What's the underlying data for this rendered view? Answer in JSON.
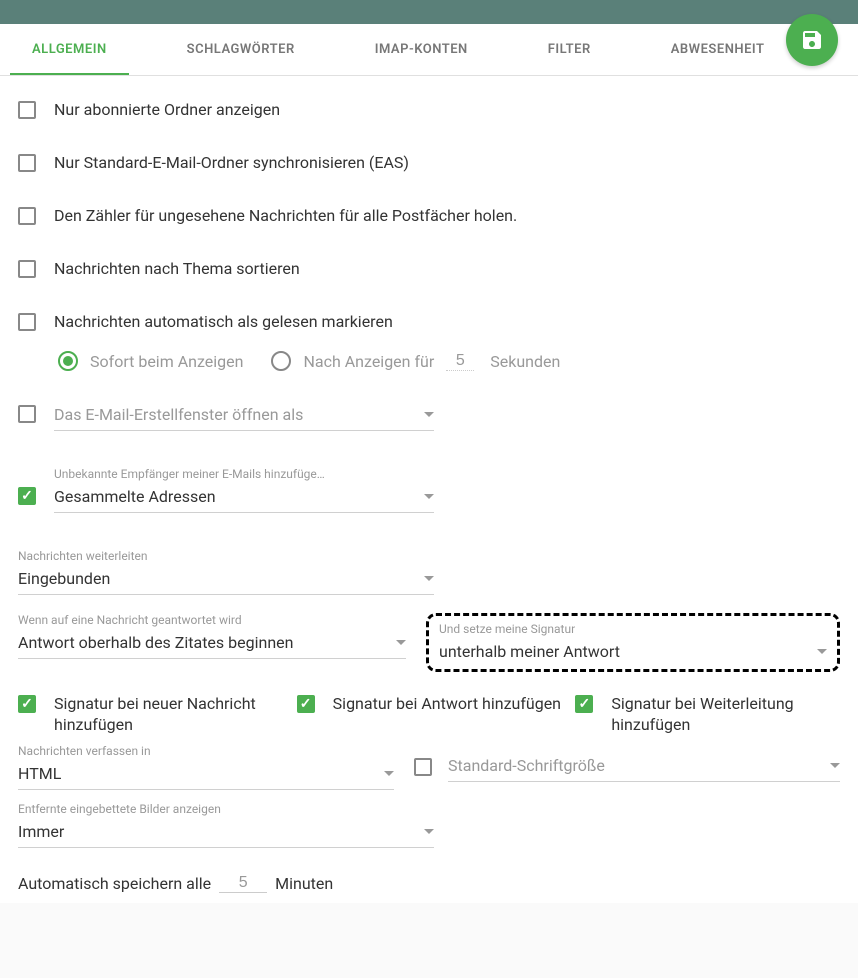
{
  "tabs": {
    "general": "ALLGEMEIN",
    "tags": "SCHLAGWÖRTER",
    "imap": "IMAP-KONTEN",
    "filter": "FILTER",
    "vacation": "ABWESENHEIT"
  },
  "options": {
    "subscribed_only": "Nur abonnierte Ordner anzeigen",
    "standard_sync": "Nur Standard-E-Mail-Ordner synchronisieren (EAS)",
    "unseen_counter": "Den Zähler für ungesehene Nachrichten für alle Postfächer holen.",
    "sort_thread": "Nachrichten nach Thema sortieren",
    "auto_read": "Nachrichten automatisch als gelesen markieren"
  },
  "radio": {
    "immediate": "Sofort beim Anzeigen",
    "after_prefix": "Nach Anzeigen für",
    "after_value": "5",
    "after_suffix": "Sekunden"
  },
  "compose_window": {
    "placeholder": "Das E-Mail-Erstellfenster öffnen als"
  },
  "unknown_recipients": {
    "label": "Unbekannte Empfänger meiner E-Mails hinzufüge…",
    "value": "Gesammelte Adressen"
  },
  "forward": {
    "label": "Nachrichten weiterleiten",
    "value": "Eingebunden"
  },
  "reply": {
    "label": "Wenn auf eine Nachricht geantwortet wird",
    "value": "Antwort oberhalb des Zitates beginnen"
  },
  "signature_place": {
    "label": "Und setze meine Signatur",
    "value": "unterhalb meiner Antwort"
  },
  "sig_checks": {
    "new": "Signatur bei neuer Nachricht hinzufügen",
    "reply": "Signatur bei Antwort hinzufügen",
    "forward": "Signatur bei Weiterleitung hinzufügen"
  },
  "compose_format": {
    "label": "Nachrichten verfassen in",
    "value": "HTML"
  },
  "font_size": {
    "placeholder": "Standard-Schriftgröße"
  },
  "remote_images": {
    "label": "Entfernte eingebettete Bilder anzeigen",
    "value": "Immer"
  },
  "autosave": {
    "prefix": "Automatisch speichern alle",
    "value": "5",
    "suffix": "Minuten"
  }
}
